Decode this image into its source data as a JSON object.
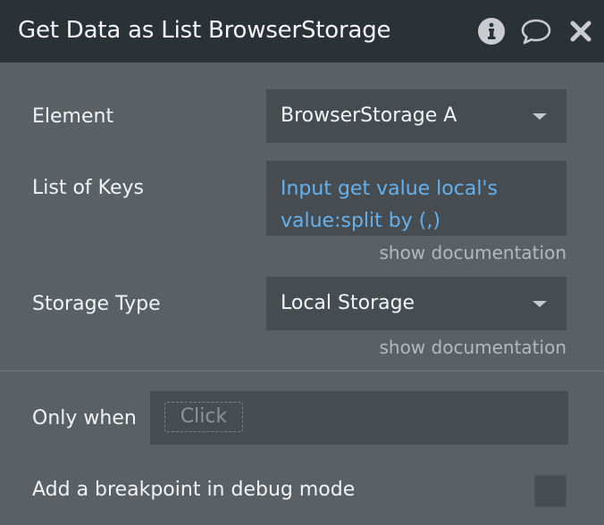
{
  "header": {
    "title": "Get Data as List BrowserStorage",
    "icons": [
      "info-icon",
      "comment-icon",
      "close-icon"
    ]
  },
  "fields": {
    "element": {
      "label": "Element",
      "value": "BrowserStorage A"
    },
    "list_of_keys": {
      "label": "List of Keys",
      "value": "Input get value local's value:split by (,)",
      "doc_link": "show documentation"
    },
    "storage_type": {
      "label": "Storage Type",
      "value": "Local Storage",
      "doc_link": "show documentation"
    }
  },
  "conditions": {
    "only_when_label": "Only when",
    "only_when_placeholder": "Click",
    "breakpoint_label": "Add a breakpoint in debug mode",
    "breakpoint_checked": false
  },
  "colors": {
    "header_bg": "#2a3236",
    "panel_bg": "#5b6064",
    "field_bg": "#464c50",
    "expression_text": "#64b1f0"
  }
}
